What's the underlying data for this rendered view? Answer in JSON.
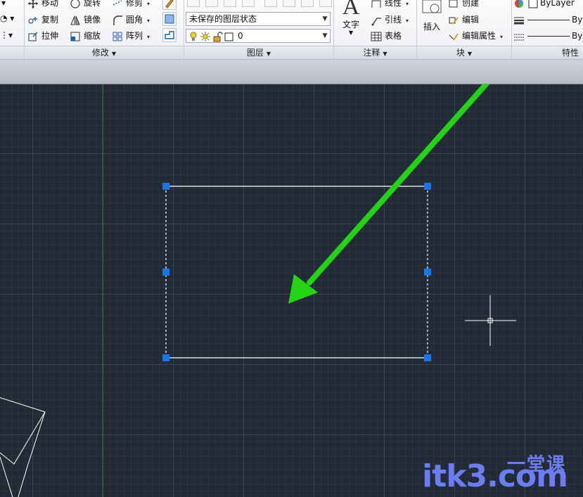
{
  "ribbon": {
    "modify": {
      "title": "修改",
      "tools": [
        {
          "label": "移动"
        },
        {
          "label": "旋转"
        },
        {
          "label": "修剪"
        },
        {
          "label": "复制"
        },
        {
          "label": "镜像"
        },
        {
          "label": "圆角"
        },
        {
          "label": "拉伸"
        },
        {
          "label": "缩放"
        },
        {
          "label": "阵列"
        }
      ]
    },
    "layers": {
      "title": "图层",
      "layer_state": "未保存的图层状态",
      "current_layer": "0"
    },
    "annotation": {
      "title": "注释",
      "text_label": "文字",
      "linear_label": "线性",
      "leader_label": "引线",
      "table_label": "表格"
    },
    "block": {
      "title": "块",
      "insert_label": "插入",
      "create_label": "创建",
      "edit_label": "编辑",
      "edit_attr_label": "编辑属性"
    },
    "properties": {
      "title": "特性",
      "color": "ByLayer",
      "linetype": "By",
      "lineweight": "By"
    }
  },
  "watermark": {
    "top": "一堂课",
    "main": "itk3.com"
  },
  "colors": {
    "canvas_bg": "#222a35",
    "grip": "#1677e6",
    "arrow": "#22d414",
    "selection_line": "#ffffff"
  }
}
